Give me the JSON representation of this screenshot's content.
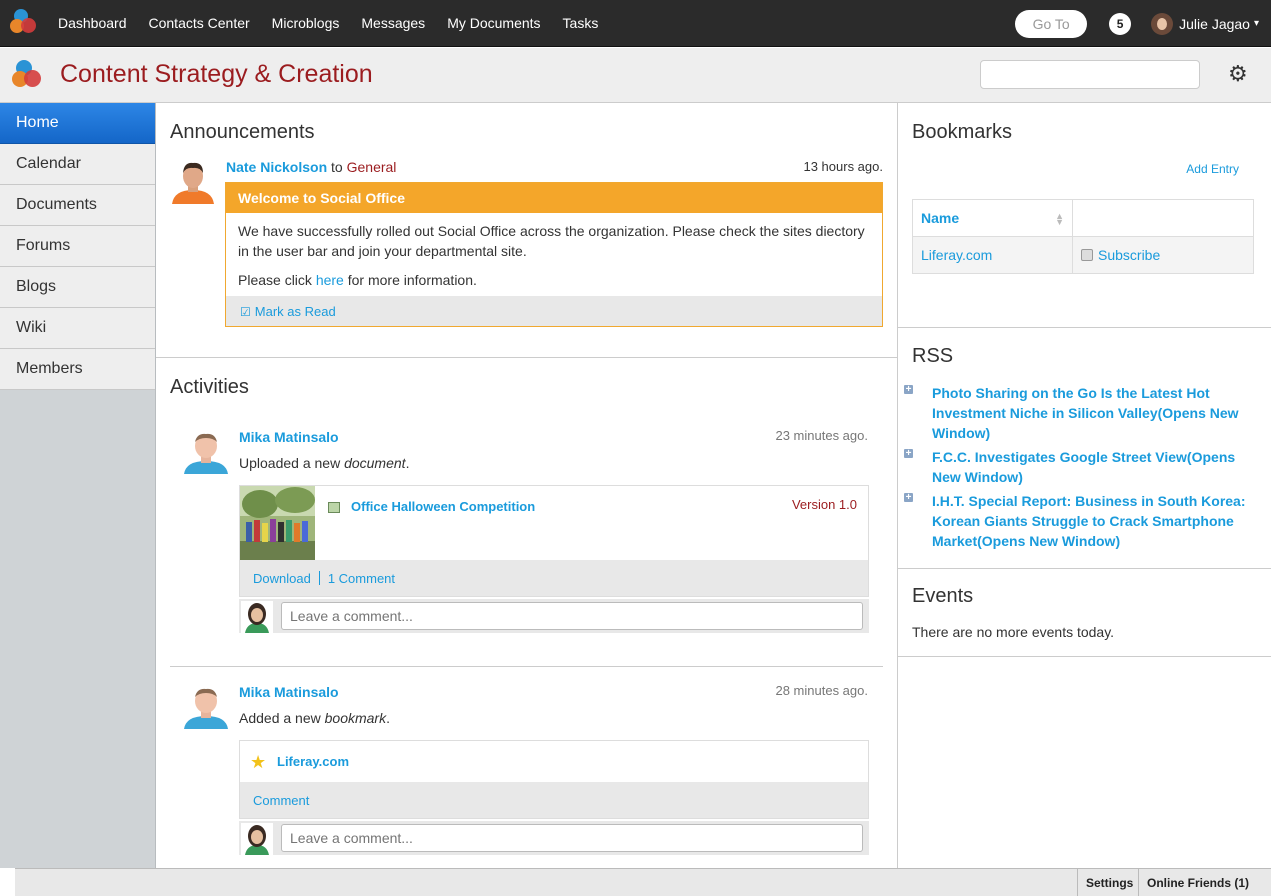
{
  "dockbar": {
    "nav": [
      "Dashboard",
      "Contacts Center",
      "Microblogs",
      "Messages",
      "My Documents",
      "Tasks"
    ],
    "goto_label": "Go To",
    "notification_count": "5",
    "user_name": "Julie Jagao",
    "caret": "▾"
  },
  "site": {
    "title": "Content Strategy & Creation",
    "gear": "⚙"
  },
  "leftnav": {
    "items": [
      "Home",
      "Calendar",
      "Documents",
      "Forums",
      "Blogs",
      "Wiki",
      "Members"
    ],
    "active": "Home"
  },
  "announcements": {
    "title": "Announcements",
    "author": "Nate Nickolson",
    "to": "to",
    "scope": "General",
    "time": "13 hours ago.",
    "headline": "Welcome to Social Office",
    "body1": "We have successfully rolled out Social Office across the organization. Please check the sites diectory in the user bar and join your departmental site.",
    "body2_prefix": "Please click ",
    "body2_link": "here",
    "body2_suffix": " for more information.",
    "mark_read": "Mark as Read",
    "check_icon": "☑"
  },
  "activities": {
    "title": "Activities",
    "items": [
      {
        "author": "Mika Matinsalo",
        "time": "23 minutes ago.",
        "desc_prefix": "Uploaded a new ",
        "desc_em": "document",
        "desc_suffix": ".",
        "doc_title": "Office Halloween Competition",
        "version": "Version 1.0",
        "download": "Download",
        "comments": "1 Comment",
        "comment_placeholder": "Leave a comment..."
      },
      {
        "author": "Mika Matinsalo",
        "time": "28 minutes ago.",
        "desc_prefix": "Added a new ",
        "desc_em": "bookmark",
        "desc_suffix": ".",
        "bookmark_title": "Liferay.com",
        "star": "★",
        "comment_link": "Comment",
        "comment_placeholder": "Leave a comment..."
      }
    ]
  },
  "bookmarks": {
    "title": "Bookmarks",
    "add_entry": "Add Entry",
    "col_name": "Name",
    "sort_up": "▲",
    "sort_down": "▼",
    "row_name": "Liferay.com",
    "row_action": "Subscribe"
  },
  "rss": {
    "title": "RSS",
    "plus": "+",
    "items": [
      "Photo Sharing on the Go Is the Latest Hot Investment Niche in Silicon Valley(Opens New Window)",
      "F.C.C. Investigates Google Street View(Opens New Window)",
      "I.H.T. Special Report: Business in South Korea: Korean Giants Struggle to Crack Smartphone Market(Opens New Window)"
    ]
  },
  "events": {
    "title": "Events",
    "text": "There are no more events today."
  },
  "bottombar": {
    "settings": "Settings",
    "online_friends": "Online Friends (1)"
  }
}
